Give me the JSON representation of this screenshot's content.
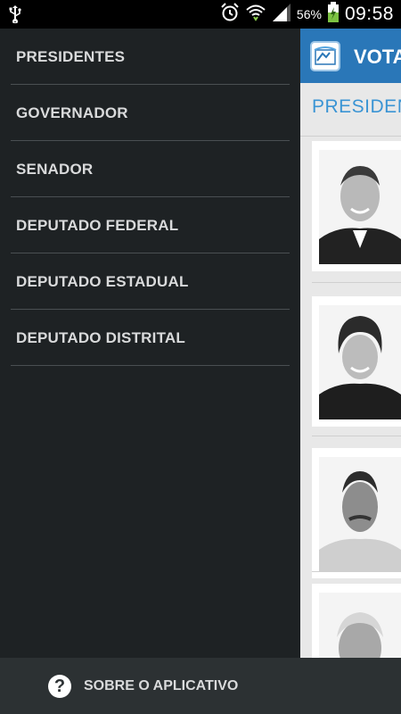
{
  "status_bar": {
    "battery_percent": "56%",
    "time": "09:58",
    "icons": [
      "usb-icon",
      "alarm-icon",
      "wifi-icon",
      "signal-icon",
      "battery-charging-icon"
    ]
  },
  "app": {
    "title": "VOTA",
    "section_title": "PRESIDEN",
    "cards": [
      {
        "name": "candidate-1"
      },
      {
        "name": "candidate-2"
      },
      {
        "name": "candidate-3"
      },
      {
        "name": "candidate-4"
      }
    ]
  },
  "drawer": {
    "items": [
      {
        "label": "PRESIDENTES"
      },
      {
        "label": "GOVERNADOR"
      },
      {
        "label": "SENADOR"
      },
      {
        "label": "DEPUTADO FEDERAL"
      },
      {
        "label": "DEPUTADO ESTADUAL"
      },
      {
        "label": "DEPUTADO DISTRITAL"
      }
    ],
    "footer": {
      "icon": "help-icon",
      "icon_glyph": "?",
      "label": "SOBRE O APLICATIVO"
    }
  }
}
